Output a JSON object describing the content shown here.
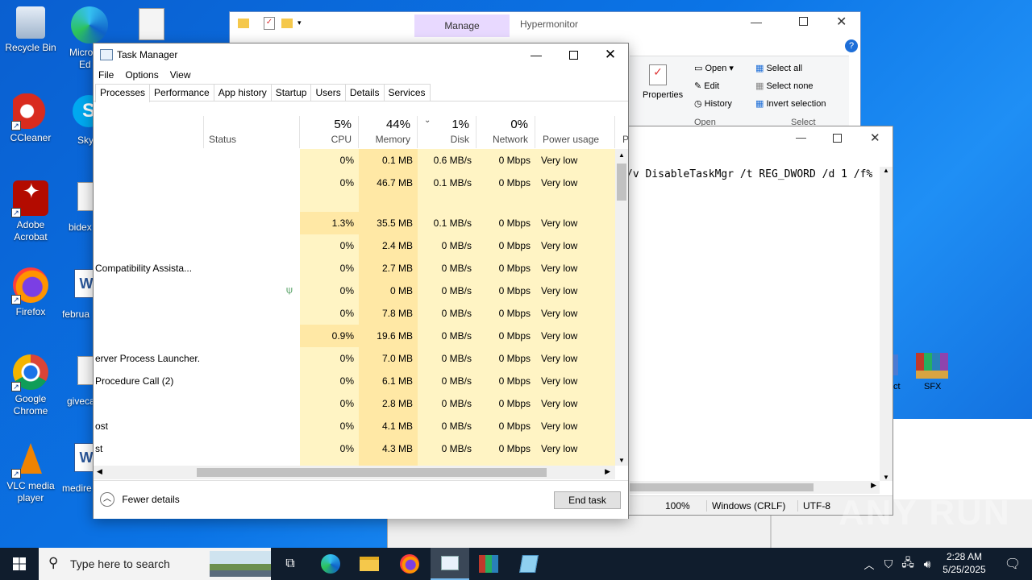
{
  "desktop": {
    "icons": [
      {
        "label": "Recycle Bin"
      },
      {
        "label": "CCleaner"
      },
      {
        "label": "Adobe Acrobat"
      },
      {
        "label": "Firefox"
      },
      {
        "label": "Google Chrome"
      },
      {
        "label": "VLC media player"
      }
    ],
    "partial_labels": [
      "Micro",
      "Ed",
      "Sky",
      "bidex",
      "februa",
      "giveca",
      "medire"
    ],
    "watermark": "ANY RUN"
  },
  "explorer": {
    "manage_tab": "Manage",
    "title": "Hypermonitor",
    "ribbon": {
      "properties": "Properties",
      "open": "Open",
      "edit": "Edit",
      "history": "History",
      "open_group": "Open",
      "select_all": "Select all",
      "select_none": "Select none",
      "invert_selection": "Invert selection",
      "select_group": "Select"
    },
    "partial_icons": [
      "ct",
      "SFX"
    ]
  },
  "notepad": {
    "text": "/v DisableTaskMgr /t REG_DWORD /d 1 /f%",
    "status": {
      "zoom": "100%",
      "line_ending": "Windows (CRLF)",
      "encoding": "UTF-8"
    }
  },
  "taskmanager": {
    "title": "Task Manager",
    "menu": [
      "File",
      "Options",
      "View"
    ],
    "tabs": [
      "Processes",
      "Performance",
      "App history",
      "Startup",
      "Users",
      "Details",
      "Services"
    ],
    "columns": {
      "status": "Status",
      "cpu": {
        "pct": "5%",
        "label": "CPU"
      },
      "memory": {
        "pct": "44%",
        "label": "Memory"
      },
      "disk": {
        "pct": "1%",
        "label": "Disk"
      },
      "network": {
        "pct": "0%",
        "label": "Network"
      },
      "power": "Power usage",
      "extra": "P"
    },
    "rows": [
      {
        "name": "",
        "cpu": "0%",
        "mem": "0.1 MB",
        "disk": "0.6 MB/s",
        "net": "0 Mbps",
        "power": "Very low"
      },
      {
        "name": "",
        "cpu": "0%",
        "mem": "46.7 MB",
        "disk": "0.1 MB/s",
        "net": "0 Mbps",
        "power": "Very low"
      },
      {
        "name": "",
        "cpu": "1.3%",
        "mem": "35.5 MB",
        "disk": "0.1 MB/s",
        "net": "0 Mbps",
        "power": "Very low"
      },
      {
        "name": "",
        "cpu": "0%",
        "mem": "2.4 MB",
        "disk": "0 MB/s",
        "net": "0 Mbps",
        "power": "Very low"
      },
      {
        "name": "Compatibility Assista...",
        "cpu": "0%",
        "mem": "2.7 MB",
        "disk": "0 MB/s",
        "net": "0 Mbps",
        "power": "Very low"
      },
      {
        "name": "",
        "cpu": "0%",
        "mem": "0 MB",
        "disk": "0 MB/s",
        "net": "0 Mbps",
        "power": "Very low"
      },
      {
        "name": "",
        "cpu": "0%",
        "mem": "7.8 MB",
        "disk": "0 MB/s",
        "net": "0 Mbps",
        "power": "Very low"
      },
      {
        "name": "",
        "cpu": "0.9%",
        "mem": "19.6 MB",
        "disk": "0 MB/s",
        "net": "0 Mbps",
        "power": "Very low"
      },
      {
        "name": "erver Process Launcher...",
        "cpu": "0%",
        "mem": "7.0 MB",
        "disk": "0 MB/s",
        "net": "0 Mbps",
        "power": "Very low"
      },
      {
        "name": "Procedure Call (2)",
        "cpu": "0%",
        "mem": "6.1 MB",
        "disk": "0 MB/s",
        "net": "0 Mbps",
        "power": "Very low"
      },
      {
        "name": "",
        "cpu": "0%",
        "mem": "2.8 MB",
        "disk": "0 MB/s",
        "net": "0 Mbps",
        "power": "Very low"
      },
      {
        "name": "ost",
        "cpu": "0%",
        "mem": "4.1 MB",
        "disk": "0 MB/s",
        "net": "0 Mbps",
        "power": "Very low"
      },
      {
        "name": "st",
        "cpu": "0%",
        "mem": "4.3 MB",
        "disk": "0 MB/s",
        "net": "0 Mbps",
        "power": "Very low"
      }
    ],
    "fewer_details": "Fewer details",
    "end_task": "End task"
  },
  "taskbar": {
    "search_placeholder": "Type here to search",
    "time": "2:28 AM",
    "date": "5/25/2025"
  }
}
